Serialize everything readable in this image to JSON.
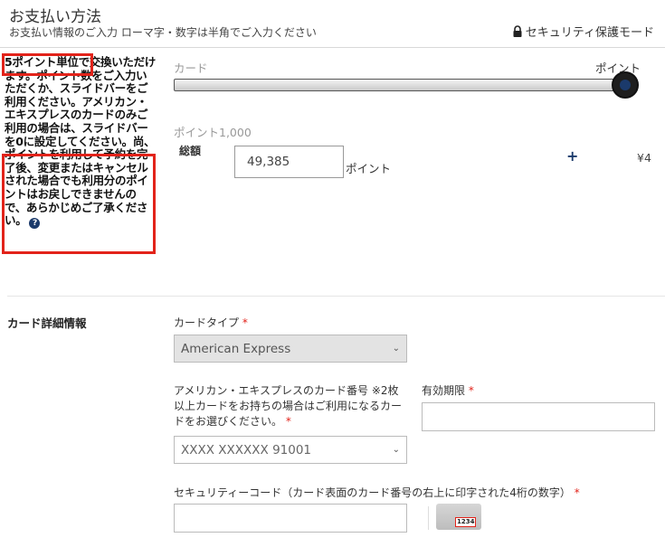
{
  "header": {
    "title": "お支払い方法",
    "subtitle": "お支払い情報のご入力 ローマ字・数字は半角でご入力ください",
    "security_mode": "セキュリティ保護モード"
  },
  "points_info": {
    "text_highlight_1": "5ポイント単位",
    "text_part_1": "で交換いただけます。ポイント数をご入力いただくか、スライドバーをご利用ください。アメリカン・エキスプレスのカードのみご利用の場合は、スライドバーを0に設定してくださ",
    "text_highlight_2": "い。尚、ポイントを利用して予約を完了後、変更またはキャンセルされた場合でも利用分のポイントはお戻しできませんので、あらかじめご了承ください。",
    "help_icon_glyph": "?"
  },
  "slider": {
    "left_label": "カード",
    "right_label": "ポイント",
    "value_fraction": 1.0
  },
  "points": {
    "caption": "ポイント1,000",
    "total_label": "総額",
    "input_value": "49,385",
    "unit": "ポイント",
    "plus": "+",
    "yen": "¥4"
  },
  "card_details": {
    "section_title": "カード詳細情報",
    "card_type_label": "カードタイプ",
    "card_type_value": "American Express",
    "card_number_label": "アメリカン・エキスプレスのカード番号 ※2枚以上カードをお持ちの場合はご利用になるカードをお選びください。",
    "card_number_value": "XXXX XXXXXX 91001",
    "expiry_label": "有効期限",
    "expiry_value": "",
    "cvv_label": "セキュリティーコード（カード表面のカード番号の右上に印字された4桁の数字）",
    "cvv_value": "",
    "cvv_example": "1234",
    "required_mark": "*",
    "chevron": "⌄"
  },
  "colors": {
    "highlight": "#e2231a",
    "accent": "#1b3a6b"
  },
  "icons": [
    "lock-icon",
    "help-icon",
    "plus-icon",
    "chevron-down-icon",
    "card-security-code-icon"
  ]
}
